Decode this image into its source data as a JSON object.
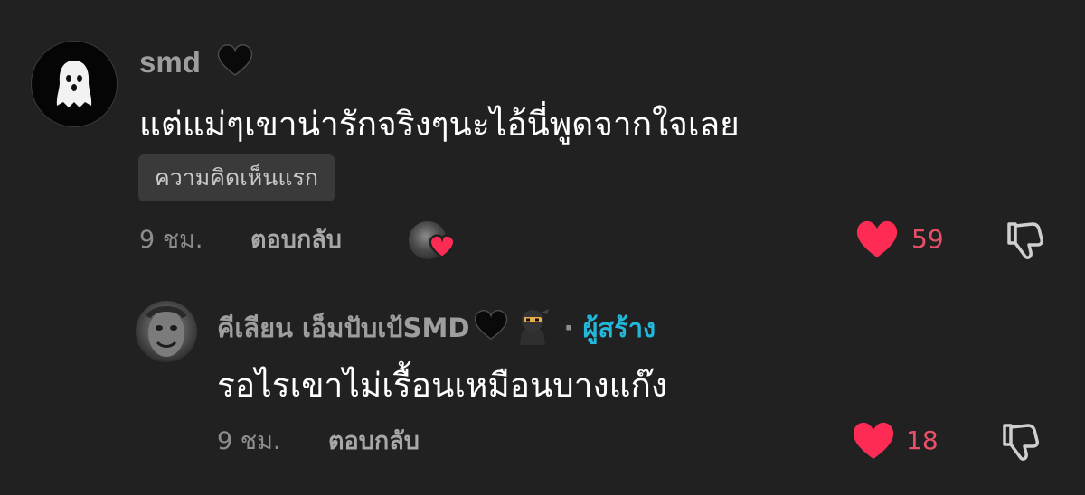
{
  "comment": {
    "username": "smd",
    "username_emoji": "black-heart-icon",
    "text": "แต่แม่ๆเขาน่ารักจริงๆนะไอ้นี่พูดจากใจเลย",
    "badge": "ความคิดเห็นแรก",
    "time": "9 ชม.",
    "reply_label": "ตอบกลับ",
    "liked_by_creator": true,
    "likes": "59"
  },
  "reply": {
    "username": "คีเลียน เอ็มปับเป้SMD",
    "username_emojis": [
      "black-heart-icon",
      "ninja-icon"
    ],
    "separator": "·",
    "creator_tag": "ผู้สร้าง",
    "text": "รอไรเขาไม่เรื้อนเหมือนบางแก๊ง",
    "time": "9 ชม.",
    "reply_label": "ตอบกลับ",
    "likes": "18"
  },
  "colors": {
    "background": "#212121",
    "like_heart": "#fe2c55",
    "like_count": "#e8506a",
    "creator_tag": "#23b7d9",
    "muted_text": "#8d8d8d"
  }
}
